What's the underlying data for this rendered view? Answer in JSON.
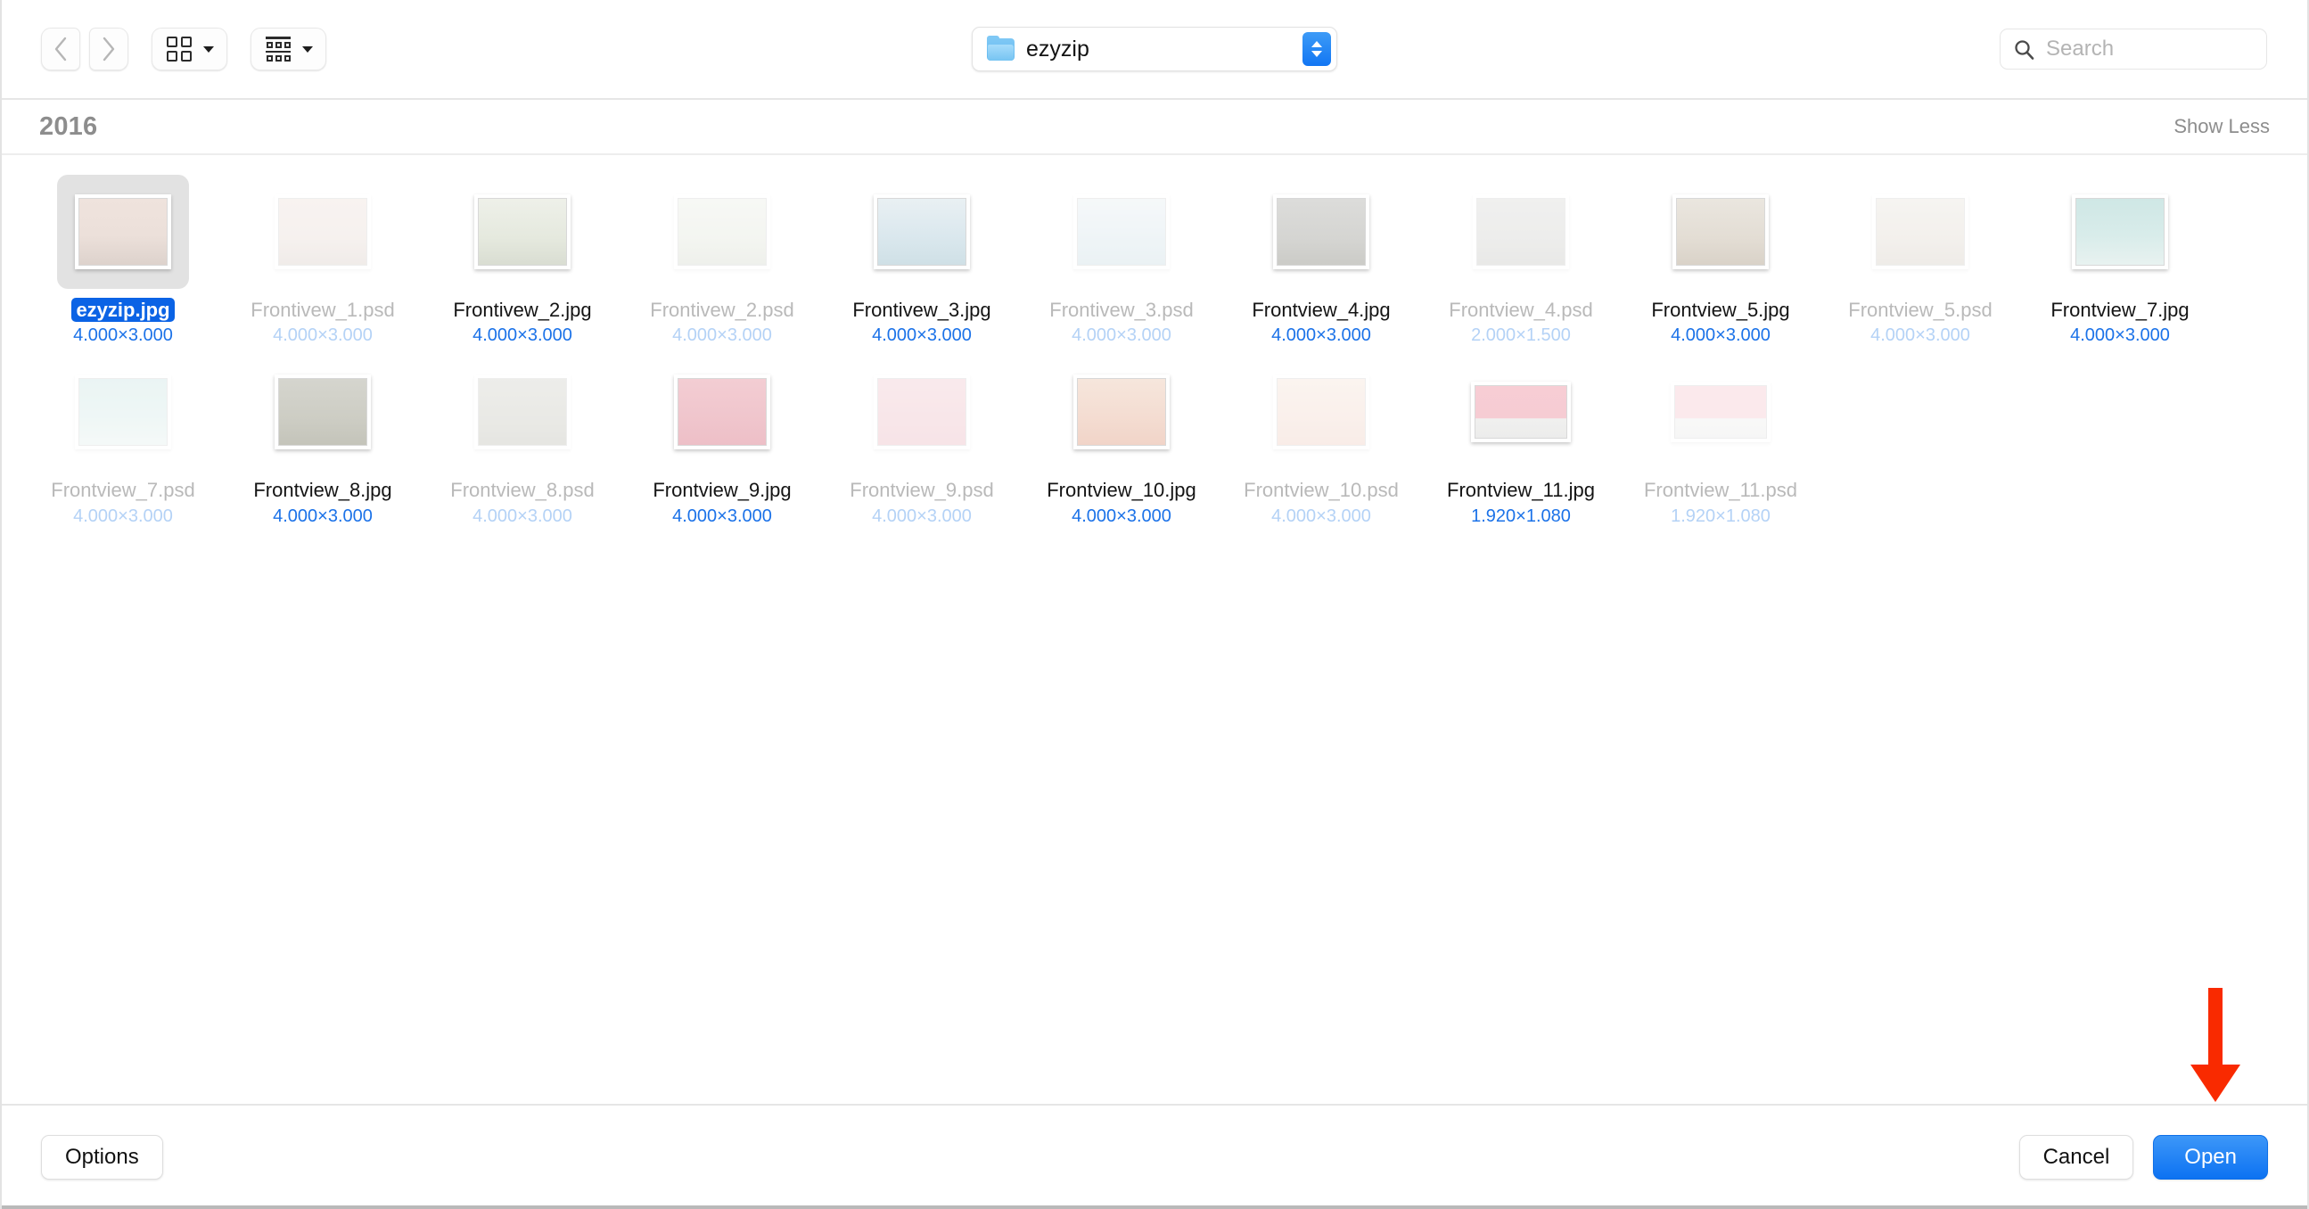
{
  "toolbar": {
    "back_icon": "chevron-left-icon",
    "forward_icon": "chevron-right-icon",
    "view_icon": "grid-view-icon",
    "group_icon": "list-view-icon",
    "path_label": "ezyzip",
    "folder_icon": "folder-icon",
    "stepper_icon": "up-down-stepper-icon",
    "search_icon": "search-icon",
    "search_value": "",
    "search_placeholder": "Search"
  },
  "group": {
    "title": "2016",
    "show_less": "Show Less"
  },
  "files": [
    {
      "name": "ezyzip.jpg",
      "dims": "4.000×3.000",
      "selected": true,
      "dim": false,
      "wide": false,
      "art": "bottle-beige"
    },
    {
      "name": "Frontivew_1.psd",
      "dims": "4.000×3.000",
      "selected": false,
      "dim": true,
      "wide": false,
      "art": "bottle-beige"
    },
    {
      "name": "Frontivew_2.jpg",
      "dims": "4.000×3.000",
      "selected": false,
      "dim": false,
      "wide": false,
      "art": "green-set"
    },
    {
      "name": "Frontivew_2.psd",
      "dims": "4.000×3.000",
      "selected": false,
      "dim": true,
      "wide": false,
      "art": "green-set"
    },
    {
      "name": "Frontivew_3.jpg",
      "dims": "4.000×3.000",
      "selected": false,
      "dim": false,
      "wide": false,
      "art": "blue-bottle"
    },
    {
      "name": "Frontivew_3.psd",
      "dims": "4.000×3.000",
      "selected": false,
      "dim": true,
      "wide": false,
      "art": "blue-bottle"
    },
    {
      "name": "Frontview_4.jpg",
      "dims": "4.000×3.000",
      "selected": false,
      "dim": false,
      "wide": false,
      "art": "frame-plant"
    },
    {
      "name": "Frontview_4.psd",
      "dims": "2.000×1.500",
      "selected": false,
      "dim": true,
      "wide": false,
      "art": "frame-plant"
    },
    {
      "name": "Frontview_5.jpg",
      "dims": "4.000×3.000",
      "selected": false,
      "dim": false,
      "wide": false,
      "art": "bonsai-box"
    },
    {
      "name": "Frontview_5.psd",
      "dims": "4.000×3.000",
      "selected": false,
      "dim": true,
      "wide": false,
      "art": "bonsai-box"
    },
    {
      "name": "Frontview_7.jpg",
      "dims": "4.000×3.000",
      "selected": false,
      "dim": false,
      "wide": false,
      "art": "mint-frame"
    },
    {
      "name": "Frontview_7.psd",
      "dims": "4.000×3.000",
      "selected": false,
      "dim": true,
      "wide": false,
      "art": "mint-frame"
    },
    {
      "name": "Frontview_8.jpg",
      "dims": "4.000×3.000",
      "selected": false,
      "dim": false,
      "wide": false,
      "art": "olive-bottles"
    },
    {
      "name": "Frontview_8.psd",
      "dims": "4.000×3.000",
      "selected": false,
      "dim": true,
      "wide": false,
      "art": "olive-bottles"
    },
    {
      "name": "Frontview_9.jpg",
      "dims": "4.000×3.000",
      "selected": false,
      "dim": false,
      "wide": false,
      "art": "pink-watch"
    },
    {
      "name": "Frontview_9.psd",
      "dims": "4.000×3.000",
      "selected": false,
      "dim": true,
      "wide": false,
      "art": "pink-watch"
    },
    {
      "name": "Frontview_10.jpg",
      "dims": "4.000×3.000",
      "selected": false,
      "dim": false,
      "wide": false,
      "art": "pink-phone"
    },
    {
      "name": "Frontview_10.psd",
      "dims": "4.000×3.000",
      "selected": false,
      "dim": true,
      "wide": false,
      "art": "pink-phone"
    },
    {
      "name": "Frontview_11.jpg",
      "dims": "1.920×1.080",
      "selected": false,
      "dim": false,
      "wide": true,
      "art": "pink-vase"
    },
    {
      "name": "Frontview_11.psd",
      "dims": "1.920×1.080",
      "selected": false,
      "dim": true,
      "wide": true,
      "art": "pink-vase"
    }
  ],
  "bottom": {
    "options_label": "Options",
    "cancel_label": "Cancel",
    "open_label": "Open"
  },
  "annotation": {
    "arrow_icon": "down-arrow-icon",
    "arrow_color": "#F92A00"
  },
  "colors": {
    "accent_blue": "#0d72f2",
    "selection_blue": "#0b63e5",
    "dims_blue": "#1b72e8",
    "arrow_red": "#F92A00"
  }
}
